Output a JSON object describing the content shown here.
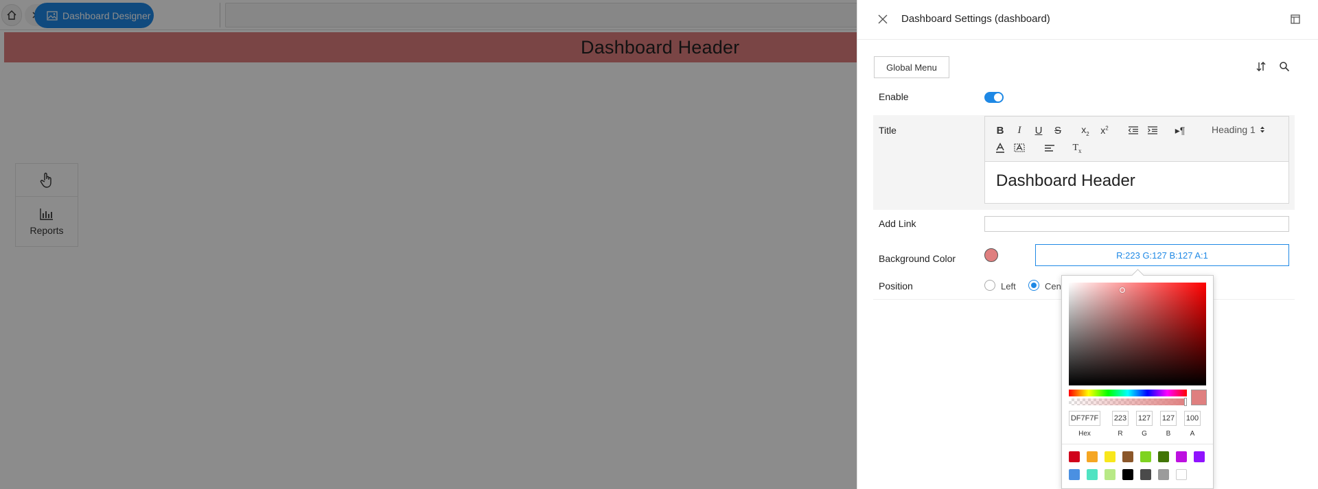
{
  "breadcrumb": {
    "active_label": "Dashboard Designer"
  },
  "dashboard": {
    "header_text": "Dashboard Header"
  },
  "tools": {
    "reports_label": "Reports"
  },
  "panel": {
    "title": "Dashboard Settings (dashboard)",
    "global_menu_label": "Global Menu",
    "enable_label": "Enable",
    "enable_on": true,
    "title_label": "Title",
    "heading_select": "Heading 1",
    "title_content": "Dashboard Header",
    "add_link_label": "Add Link",
    "add_link_value": "",
    "bg_color_label": "Background Color",
    "bg_color_value": "R:223 G:127 B:127 A:1",
    "position_label": "Position",
    "position_options": [
      "Left",
      "Cen"
    ]
  },
  "picker": {
    "hex": "DF7F7F",
    "r": "223",
    "g": "127",
    "b": "127",
    "a": "100",
    "labels": {
      "hex": "Hex",
      "r": "R",
      "g": "G",
      "b": "B",
      "a": "A"
    },
    "swatches": [
      "#d0021b",
      "#f5a623",
      "#f8e71c",
      "#8b572a",
      "#7ed321",
      "#417505",
      "#bd10e0",
      "#9013fe",
      "#4a90e2",
      "#50e3c2",
      "#b8e986",
      "#000000",
      "#4a4a4a",
      "#9b9b9b",
      "#ffffff"
    ]
  },
  "colors": {
    "accent": "#1e88e5",
    "header_bg": "#df7f7f"
  }
}
